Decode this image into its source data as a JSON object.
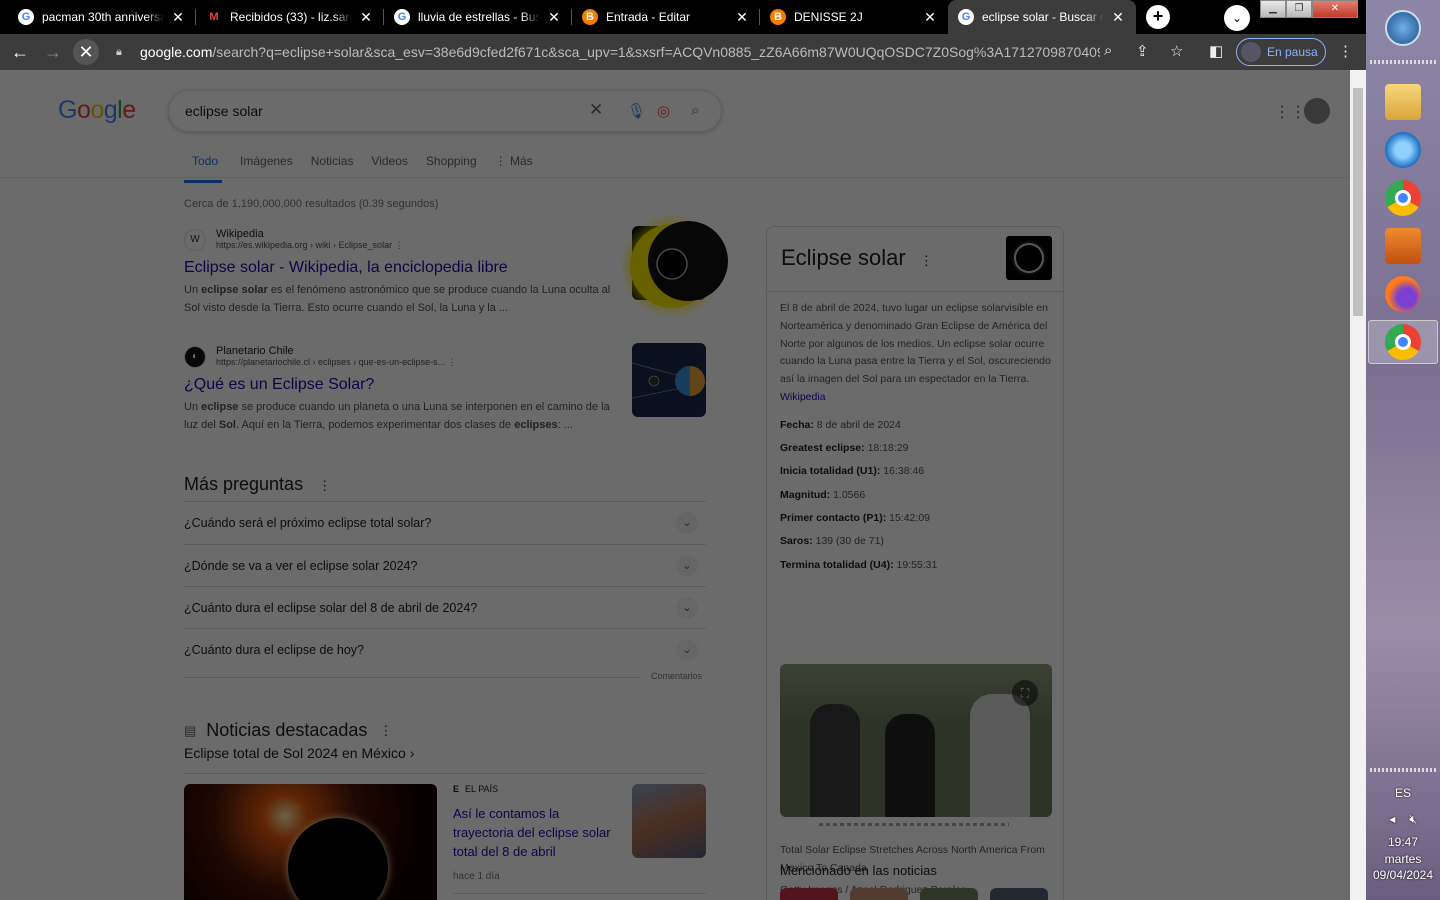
{
  "tabs": [
    {
      "title": "pacman 30th anniversary",
      "fav": "G",
      "type": "google"
    },
    {
      "title": "Recibidos (33) - liz.santi",
      "fav": "M",
      "type": "gmail"
    },
    {
      "title": "lluvia de estrellas - Buscar",
      "fav": "G",
      "type": "google"
    },
    {
      "title": "Entrada - Editar",
      "fav": "B",
      "type": "blogger"
    },
    {
      "title": "DENISSE 2J",
      "fav": "B",
      "type": "blogger"
    },
    {
      "title": "eclipse solar - Buscar con Google",
      "fav": "G",
      "type": "google"
    }
  ],
  "toolbar": {
    "url_host": "google.com",
    "url_rest": "/search?q=eclipse+solar&sca_esv=38e6d9cfed2f671c&sca_upv=1&sxsrf=ACQVn0885_zZ6A66m87W0UQqOSDC7Z0Sog%3A1712709870409...",
    "paused_label": "En pausa"
  },
  "search": {
    "query": "eclipse solar"
  },
  "nav_tabs": [
    "Todo",
    "Imágenes",
    "Noticias",
    "Videos",
    "Shopping",
    "Más"
  ],
  "stats": "Cerca de 1,190,000,000 resultados (0.39 segundos)",
  "results": [
    {
      "site": "Wikipedia",
      "url": "https://es.wikipedia.org › wiki › Eclipse_solar",
      "title": "Eclipse solar - Wikipedia, la enciclopedia libre",
      "snippet_html": "Un <b>eclipse solar</b> es el fenómeno astronómico que se produce cuando la Luna oculta al Sol visto desde la Tierra. Esto ocurre cuando el Sol, la Luna y la ...",
      "icon": "W"
    },
    {
      "site": "Planetario Chile",
      "url": "https://planetariochile.cl › eclipses › que-es-un-eclipse-s...",
      "title": "¿Qué es un Eclipse Solar?",
      "snippet_html": "Un <b>eclipse</b> se produce cuando un planeta o una Luna se interponen en el camino de la luz del <b>Sol</b>. Aquí en la Tierra, podemos experimentar dos clases de <b>eclipses</b>: ...",
      "icon": "◐"
    }
  ],
  "paa": {
    "heading": "Más preguntas",
    "questions": [
      "¿Cuándo será el próximo eclipse total solar?",
      "¿Dónde se va a ver el eclipse solar 2024?",
      "¿Cuánto dura el eclipse solar del 8 de abril de 2024?",
      "¿Cuánto dura el eclipse de hoy?"
    ],
    "feedback": "Comentarios"
  },
  "news": {
    "heading": "Noticias destacadas",
    "sub": "Eclipse total de Sol 2024 en México",
    "item": {
      "source": "EL PAÍS",
      "title": "Así le contamos la trayectoria del eclipse solar total del 8 de abril",
      "time": "hace 1 día"
    }
  },
  "knowledge_panel": {
    "title": "Eclipse solar",
    "description": "El 8 de abril de 2024, tuvo lugar un eclipse solarvisible en Norteamérica y denominado Gran Eclipse de América del Norte por algunos de los medios. Un eclipse solar ocurre cuando la Luna pasa entre la Tierra y el Sol, oscureciendo así la imagen del Sol para un espectador en la Tierra.",
    "source_link": "Wikipedia",
    "facts": [
      {
        "label": "Fecha:",
        "value": "8 de abril de 2024"
      },
      {
        "label": "Greatest eclipse:",
        "value": "18:18:29"
      },
      {
        "label": "Inicia totalidad (U1):",
        "value": "16:38:46"
      },
      {
        "label": "Magnitud:",
        "value": "1.0566"
      },
      {
        "label": "Primer contacto (P1):",
        "value": "15:42:09"
      },
      {
        "label": "Saros:",
        "value": "139 (30 de 71)"
      },
      {
        "label": "Termina totalidad (U4):",
        "value": "19:55:31"
      }
    ],
    "photo_caption": "Total Solar Eclipse Stretches Across North America From Mexico To Canada",
    "photo_credit": "Getty Images / Azael Rodriguez Perales",
    "mentioned": "Mencionado en las noticias"
  },
  "taskbar": {
    "lang": "ES",
    "time": "19:47",
    "day": "martes",
    "date": "09/04/2024"
  }
}
